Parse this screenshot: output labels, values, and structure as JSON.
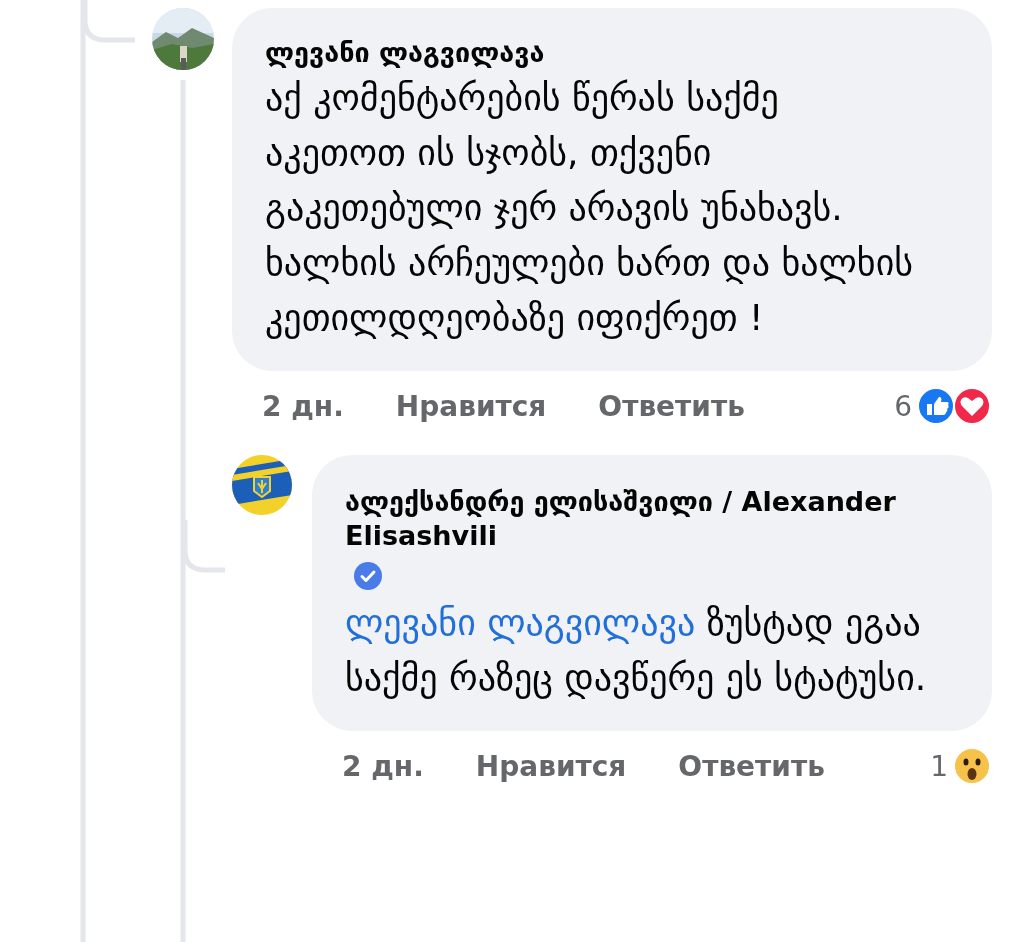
{
  "comments": [
    {
      "author": "ლევანი ლაგვილავა",
      "verified": false,
      "text": "აქ კომენტარების წერას საქმე აკეთოთ ის სჯობს, თქვენი გაკეთებული ჯერ არავის უნახავს. ხალხის არჩეულები ხართ და ხალხის კეთილდღეობაზე იფიქრეთ !",
      "time": "2 дн.",
      "like": "Нравится",
      "reply": "Ответить",
      "reaction_count": "6",
      "reactions": [
        {
          "kind": "like"
        },
        {
          "kind": "love"
        }
      ]
    },
    {
      "author": "ალექსანდრე ელისაშვილი / Alexander Elisashvili",
      "verified": true,
      "mention": "ლევანი ლაგვილავა",
      "text": "ზუსტად ეგაა საქმე რაზეც დავწერე ეს სტატუსი.",
      "time": "2 дн.",
      "like": "Нравится",
      "reply": "Ответить",
      "reaction_count": "1",
      "reactions": [
        {
          "kind": "wow"
        }
      ]
    }
  ]
}
